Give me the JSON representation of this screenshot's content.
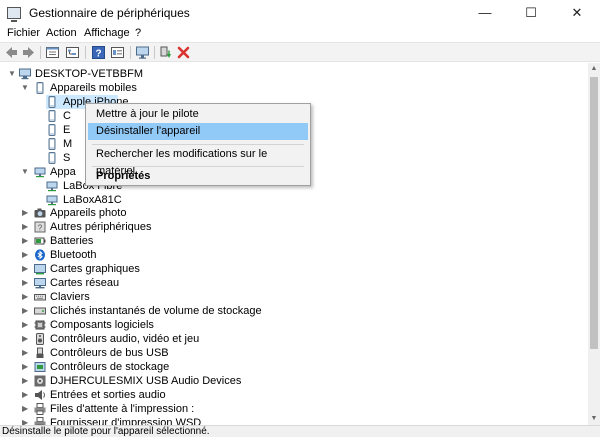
{
  "window": {
    "title": "Gestionnaire de périphériques",
    "minimize_glyph": "—",
    "maximize_glyph": "☐",
    "close_glyph": "✕"
  },
  "menu": [
    "Fichier",
    "Action",
    "Affichage",
    "?"
  ],
  "toolbar": {
    "icons": [
      "back-arrow-icon",
      "forward-arrow-icon",
      "properties-icon",
      "tree-view-icon",
      "help-icon",
      "details-icon",
      "monitor-icon",
      "update-driver-icon",
      "uninstall-icon"
    ]
  },
  "tree": {
    "root": "DESKTOP-VETBBFM",
    "mobile": {
      "category": "Appareils mobiles",
      "children": [
        "Apple iPhone",
        "C",
        "E",
        "M",
        "S"
      ]
    },
    "next_category_partial": "Appa",
    "network_children": [
      "LaBox Fibre",
      "LaBoxA81C"
    ],
    "categories": [
      "Appareils photo",
      "Autres périphériques",
      "Batteries",
      "Bluetooth",
      "Cartes graphiques",
      "Cartes réseau",
      "Claviers",
      "Clichés instantanés de volume de stockage",
      "Composants logiciels",
      "Contrôleurs audio, vidéo et jeu",
      "Contrôleurs de bus USB",
      "Contrôleurs de stockage",
      "DJHERCULESMIX USB Audio Devices",
      "Entrées et sorties audio",
      "Files d'attente à l'impression :",
      "Fournisseur d'impression WSD"
    ]
  },
  "context_menu": {
    "items": [
      "Mettre à jour le pilote",
      "Désinstaller l'appareil",
      "Rechercher les modifications sur le matériel",
      "Propriétés"
    ],
    "highlighted_index": 1
  },
  "status": "Désinstalle le pilote pour l'appareil sélectionné.",
  "colors": {
    "highlight": "#91c9f7",
    "selection": "#cce8ff",
    "uninstall_red": "#d9322e",
    "update_green": "#2e9a3e"
  }
}
